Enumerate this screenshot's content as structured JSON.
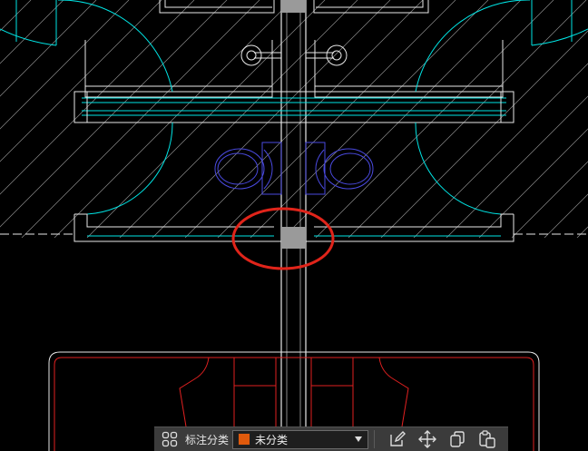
{
  "drawing": {
    "colors": {
      "background": "#000000",
      "hatch": "#8a8a8a",
      "cyan": "#00e5e5",
      "white": "#e8e8e8",
      "blue": "#4a4ae0",
      "red": "#e02020",
      "highlight_circle": "#e0241a",
      "block_gray": "#9a9a9a"
    },
    "annotation": "highlight-circle-around-wall-joint"
  },
  "toolbar": {
    "layout_icon": "four-squares-icon",
    "category_label": "标注分类",
    "category_select": {
      "value": "未分类",
      "swatch_color": "#e05a0c"
    },
    "actions": [
      {
        "name": "edit-annotation-button",
        "icon": "pencil-edit-icon"
      },
      {
        "name": "move-button",
        "icon": "move-arrows-icon"
      },
      {
        "name": "copy-button",
        "icon": "copy-icon"
      },
      {
        "name": "paste-button",
        "icon": "paste-icon"
      }
    ]
  }
}
